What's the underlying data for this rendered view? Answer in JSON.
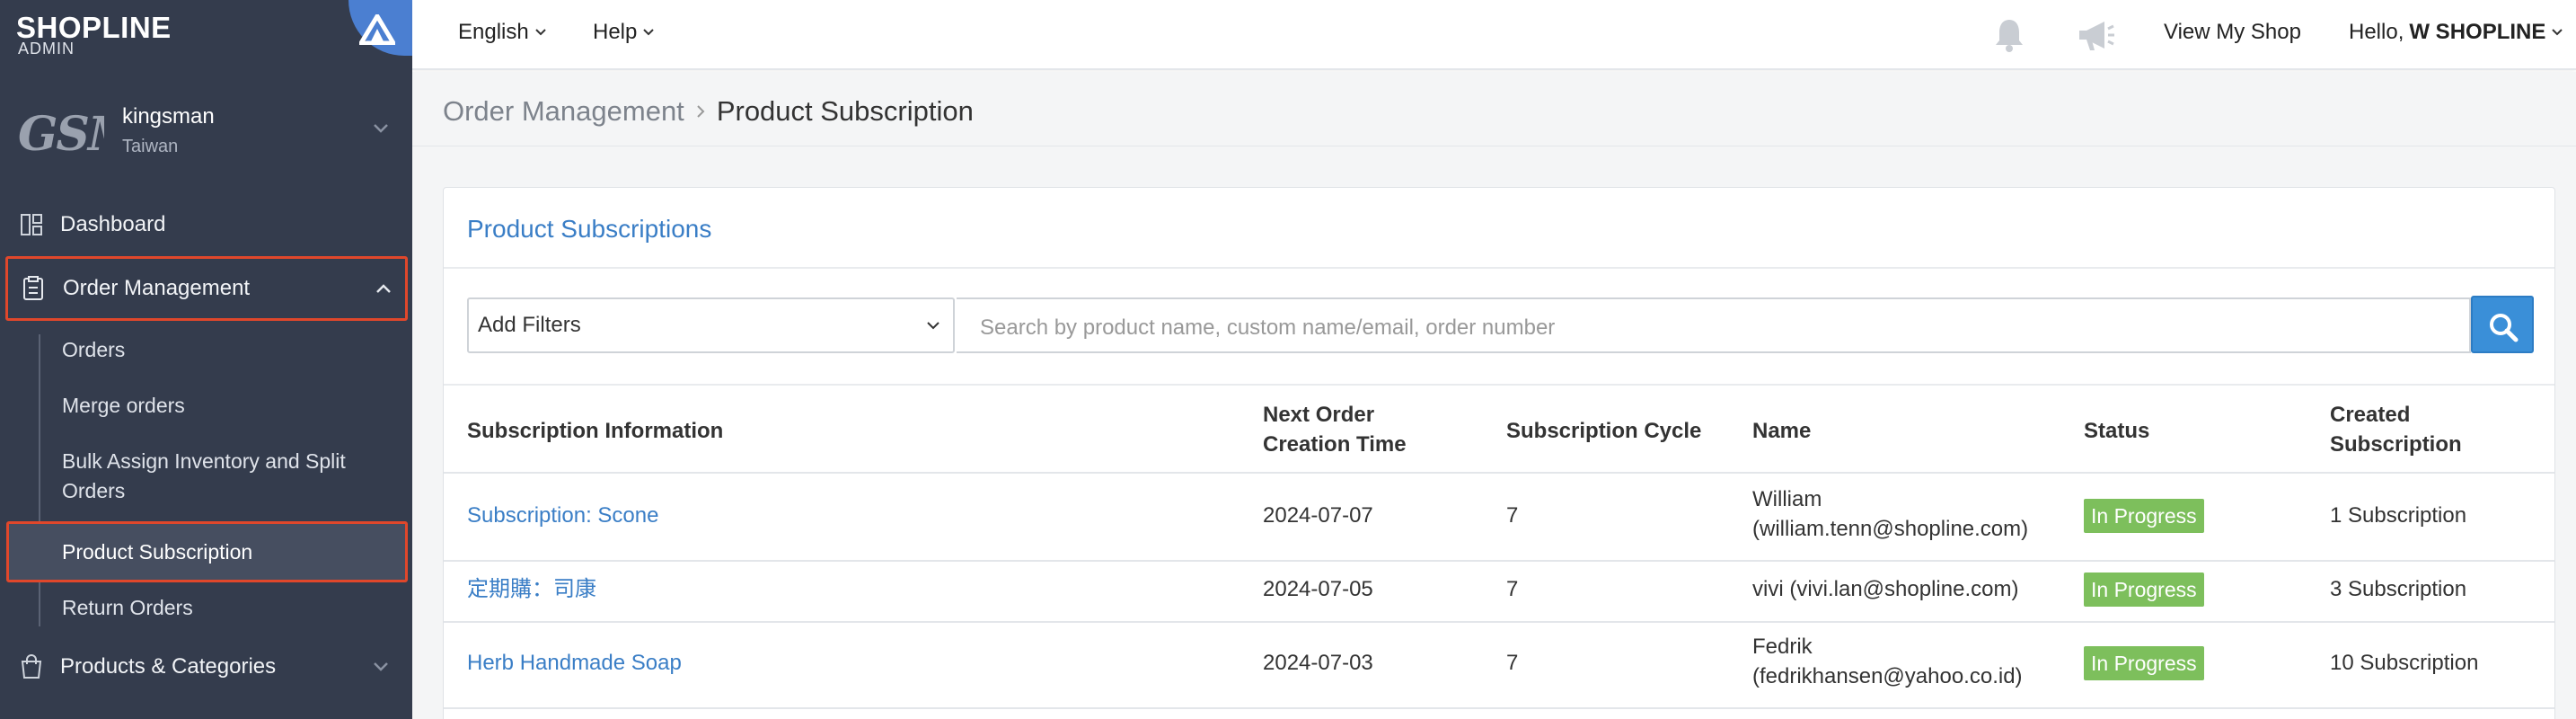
{
  "app": {
    "logo_text": "SHOPLINE",
    "logo_sub": "ADMIN"
  },
  "store": {
    "logo_text": "GSM",
    "name": "kingsman",
    "region": "Taiwan"
  },
  "sidebar": {
    "dashboard": "Dashboard",
    "order_management": "Order Management",
    "sub_items": [
      "Orders",
      "Merge orders",
      "Bulk Assign Inventory and Split Orders",
      "Product Subscription",
      "Return Orders"
    ],
    "products": "Products & Categories"
  },
  "topbar": {
    "language": "English",
    "help": "Help",
    "view_shop": "View My Shop",
    "hello_prefix": "Hello,",
    "user": "W SHOPLINE"
  },
  "breadcrumb": {
    "parent": "Order Management",
    "current": "Product Subscription"
  },
  "card": {
    "title": "Product Subscriptions",
    "filter_label": "Add Filters",
    "search_placeholder": "Search by product name, custom name/email, order number"
  },
  "table": {
    "columns": [
      "Subscription Information",
      "Next Order Creation Time",
      "Subscription Cycle",
      "Name",
      "Status",
      "Created Subscription"
    ],
    "rows": [
      {
        "info": "Subscription: Scone",
        "next": "2024-07-07",
        "cycle": "7",
        "name": "William (william.tenn@shopline.com)",
        "status": "In Progress",
        "created": "1 Subscription"
      },
      {
        "info": "定期購：司康",
        "next": "2024-07-05",
        "cycle": "7",
        "name": "vivi (vivi.lan@shopline.com)",
        "status": "In Progress",
        "created": "3 Subscription"
      },
      {
        "info": "Herb Handmade Soap",
        "next": "2024-07-03",
        "cycle": "7",
        "name": "Fedrik (fedrikhansen@yahoo.co.id)",
        "status": "In Progress",
        "created": "10 Subscription"
      }
    ]
  },
  "colors": {
    "sidebar_bg": "#343c4d",
    "accent": "#3a7ec6",
    "highlight_border": "#e0472b",
    "status_green": "#7dbf5c"
  }
}
